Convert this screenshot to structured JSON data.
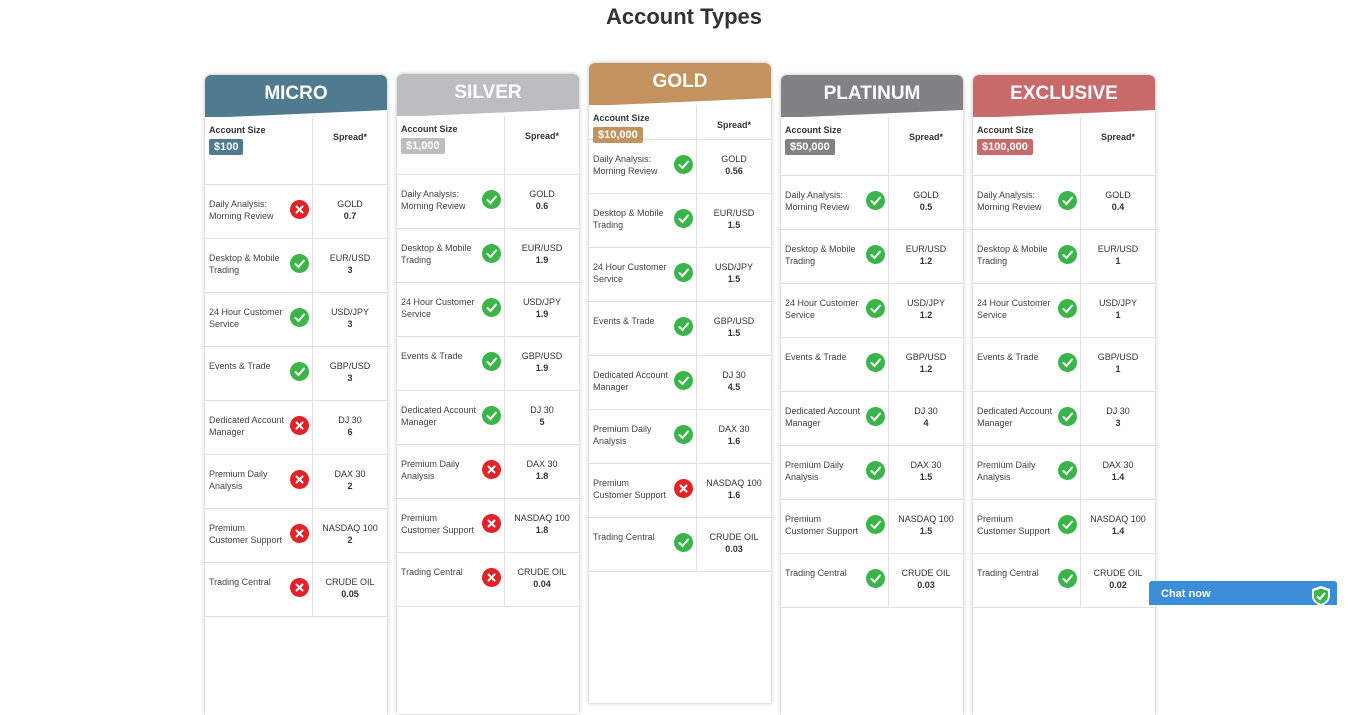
{
  "page_title": "Account Types",
  "account_size_label": "Account Size",
  "spread_label": "Spread*",
  "feature_names": [
    "Daily Analysis: Morning Review",
    "Desktop & Mobile Trading",
    "24 Hour Customer Service",
    "Events & Trade",
    "Dedicated Account Manager",
    "Premium Daily Analysis",
    "Premium Customer Support",
    "Trading Central"
  ],
  "instrument_names": [
    "GOLD",
    "EUR/USD",
    "USD/JPY",
    "GBP/USD",
    "DJ 30",
    "DAX 30",
    "NASDAQ 100",
    "CRUDE OIL"
  ],
  "colors": {
    "check": "#3bb54a",
    "cross": "#e32227",
    "chat": "#3c8dd8"
  },
  "accounts": [
    {
      "name": "MICRO",
      "size": "$100",
      "color": "#4f7a8f",
      "features": [
        false,
        true,
        true,
        true,
        false,
        false,
        false,
        false
      ],
      "spreads": [
        "0.7",
        "3",
        "3",
        "3",
        "6",
        "2",
        "2",
        "0.05"
      ]
    },
    {
      "name": "SILVER",
      "size": "$1,000",
      "color": "#bcbdc0",
      "features": [
        true,
        true,
        true,
        true,
        true,
        false,
        false,
        false
      ],
      "spreads": [
        "0.6",
        "1.9",
        "1.9",
        "1.9",
        "5",
        "1.8",
        "1.8",
        "0.04"
      ]
    },
    {
      "name": "GOLD",
      "size": "$10,000",
      "color": "#c3935f",
      "features": [
        true,
        true,
        true,
        true,
        true,
        true,
        false,
        true
      ],
      "spreads": [
        "0.56",
        "1.5",
        "1.5",
        "1.5",
        "4.5",
        "1.6",
        "1.6",
        "0.03"
      ]
    },
    {
      "name": "PLATINUM",
      "size": "$50,000",
      "color": "#818285",
      "features": [
        true,
        true,
        true,
        true,
        true,
        true,
        true,
        true
      ],
      "spreads": [
        "0.5",
        "1.2",
        "1.2",
        "1.2",
        "4",
        "1.5",
        "1.5",
        "0.03"
      ]
    },
    {
      "name": "EXCLUSIVE",
      "size": "$100,000",
      "color": "#c86a6a",
      "features": [
        true,
        true,
        true,
        true,
        true,
        true,
        true,
        true
      ],
      "spreads": [
        "0.4",
        "1",
        "1",
        "1",
        "3",
        "1.4",
        "1.4",
        "0.02"
      ]
    }
  ],
  "chat": {
    "label": "Chat now",
    "icon": "shield-check-icon"
  }
}
